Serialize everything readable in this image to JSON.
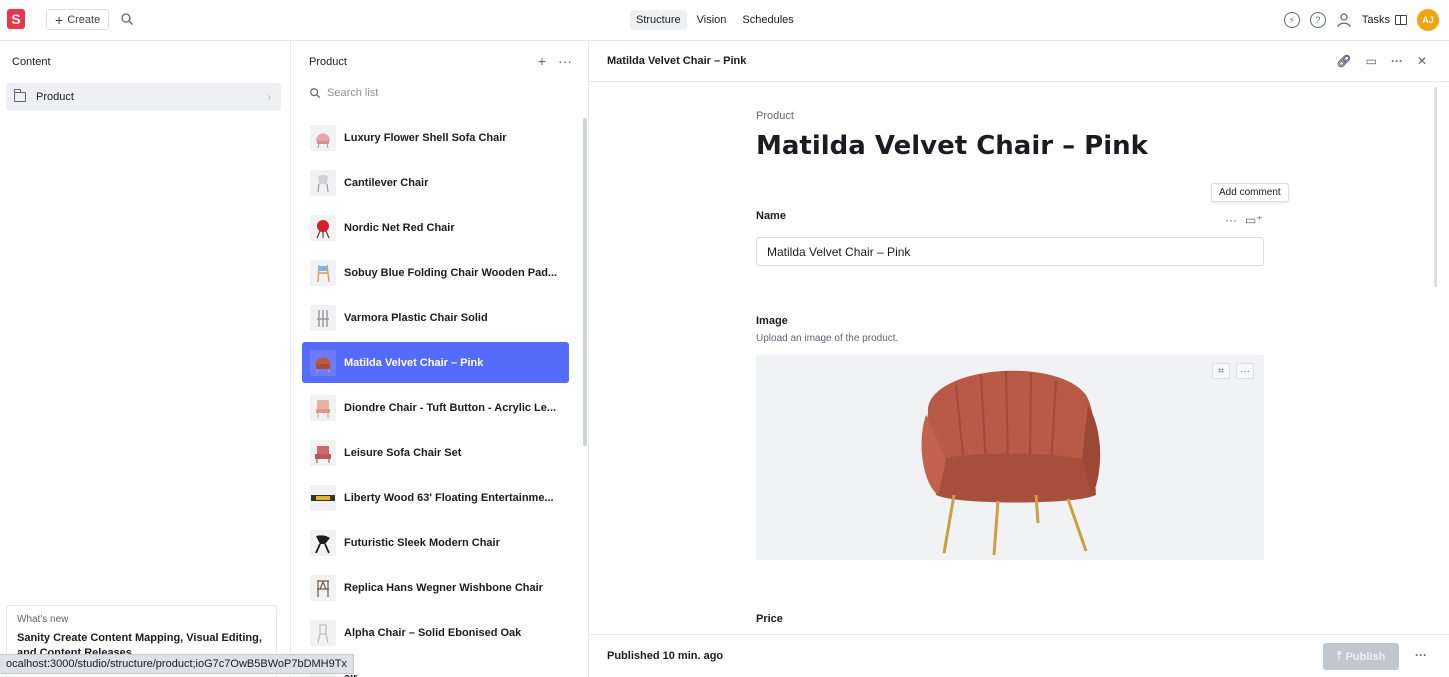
{
  "topbar": {
    "logo": "S",
    "create_label": "Create",
    "nav": [
      "Structure",
      "Vision",
      "Schedules"
    ],
    "tasks_label": "Tasks",
    "avatar_initials": "AJ"
  },
  "content_pane": {
    "title": "Content",
    "items": [
      {
        "label": "Product"
      }
    ]
  },
  "whats_new": {
    "label": "What's new",
    "title": "Sanity Create Content Mapping, Visual Editing, and Content Releases"
  },
  "status_url": "ocalhost:3000/studio/structure/product;ioG7c7OwB5BWoP7bDMH9Tx",
  "list_pane": {
    "title": "Product",
    "search_placeholder": "Search list",
    "items": [
      {
        "label": "Luxury Flower Shell Sofa Chair"
      },
      {
        "label": "Cantilever Chair"
      },
      {
        "label": "Nordic Net Red Chair"
      },
      {
        "label": "Sobuy Blue Folding Chair Wooden Pad..."
      },
      {
        "label": "Varmora Plastic Chair Solid"
      },
      {
        "label": "Matilda Velvet Chair – Pink"
      },
      {
        "label": "Diondre Chair - Tuft Button - Acrylic Le..."
      },
      {
        "label": "Leisure Sofa Chair Set"
      },
      {
        "label": "Liberty Wood 63' Floating Entertainme..."
      },
      {
        "label": "Futuristic Sleek Modern Chair"
      },
      {
        "label": "Replica Hans Wegner Wishbone Chair"
      },
      {
        "label": "Alpha Chair – Solid Ebonised Oak"
      },
      {
        "label": "air"
      }
    ],
    "selected_index": 5
  },
  "document": {
    "header_title": "Matilda Velvet Chair – Pink",
    "type_label": "Product",
    "title": "Matilda Velvet Chair – Pink",
    "tooltip": "Add comment",
    "name_label": "Name",
    "name_value": "Matilda Velvet Chair – Pink",
    "image_label": "Image",
    "image_desc": "Upload an image of the product.",
    "price_label": "Price",
    "status": "Published 10 min. ago",
    "publish_label": "Publish"
  },
  "colors": {
    "accent": "#556bfc",
    "logo": "#e8364d",
    "avatar": "#f1a40c",
    "chair": "#b85a45"
  }
}
